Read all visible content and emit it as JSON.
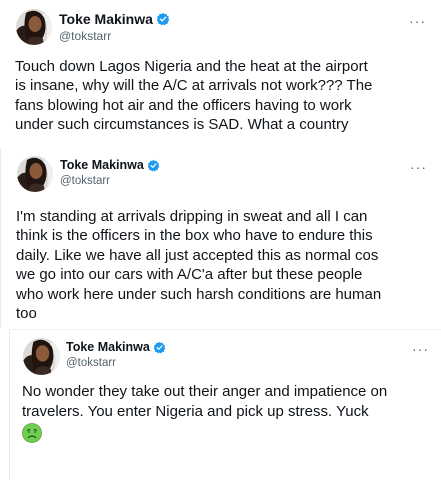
{
  "colors": {
    "verified_blue": "#1d9bf0",
    "text_primary": "#0f1419",
    "text_secondary": "#536471",
    "emoji_face": "#6fcf50"
  },
  "icons": {
    "verified": "verified-badge-icon",
    "more": "more-horizontal-icon",
    "emoji": "nauseated-face-emoji"
  },
  "tweets": [
    {
      "author": {
        "name": "Toke Makinwa",
        "handle": "@tokstarr"
      },
      "more_label": "···",
      "lines": [
        "Touch down Lagos Nigeria and the heat at the airport",
        "is insane, why will the A/C at arrivals not work??? The",
        "fans blowing hot air and the officers having to work",
        "under such circumstances is SAD. What a country"
      ]
    },
    {
      "author": {
        "name": "Toke Makinwa",
        "handle": "@tokstarr"
      },
      "more_label": "···",
      "lines": [
        "I'm standing at arrivals dripping in sweat and all I can",
        "think is the officers in the box who have to endure this",
        "daily. Like we have all just accepted this as normal cos",
        "we go into our cars with A/C'a after but these people",
        "who work here under such harsh conditions are human",
        "too"
      ]
    },
    {
      "author": {
        "name": "Toke Makinwa",
        "handle": "@tokstarr"
      },
      "more_label": "···",
      "lines": [
        "No wonder they take out their anger and impatience on",
        "travelers. You enter Nigeria and pick up stress. Yuck"
      ]
    }
  ]
}
